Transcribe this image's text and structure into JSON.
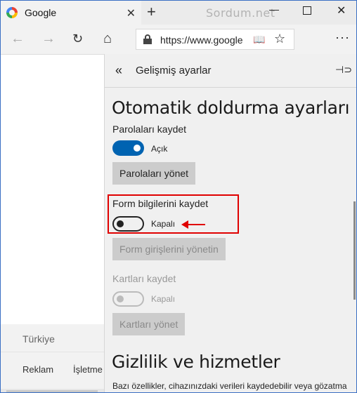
{
  "browser": {
    "tab_title": "Google",
    "tab_close": "✕",
    "new_tab": "+",
    "watermark": "Sordum.net",
    "window_min": "—",
    "window_close": "✕"
  },
  "navbar": {
    "url": "https://www.google",
    "reader": "📖",
    "favorite": "☆",
    "more": "···"
  },
  "page": {
    "country": "Türkiye",
    "footer_links": [
      "Reklam",
      "İşletme"
    ]
  },
  "panel": {
    "title": "Gelişmiş ayarlar",
    "autofill_heading": "Otomatik doldurma ayarları",
    "save_passwords_label": "Parolaları kaydet",
    "save_passwords_state": "Açık",
    "save_passwords_on": true,
    "manage_passwords_button": "Parolaları yönet",
    "save_forms_label": "Form bilgilerini kaydet",
    "save_forms_state": "Kapalı",
    "save_forms_on": false,
    "manage_forms_button": "Form girişlerini yönetin",
    "save_cards_label": "Kartları kaydet",
    "save_cards_state": "Kapalı",
    "save_cards_on": false,
    "manage_cards_button": "Kartları yönet",
    "privacy_heading": "Gizlilik ve hizmetler",
    "privacy_desc": "Bazı özellikler, cihazınızdaki verileri kaydedebilir veya gözatma"
  },
  "colors": {
    "toggle_on": "#0063b1",
    "highlight": "#e00000",
    "panel_bg": "#f0f0f0"
  }
}
